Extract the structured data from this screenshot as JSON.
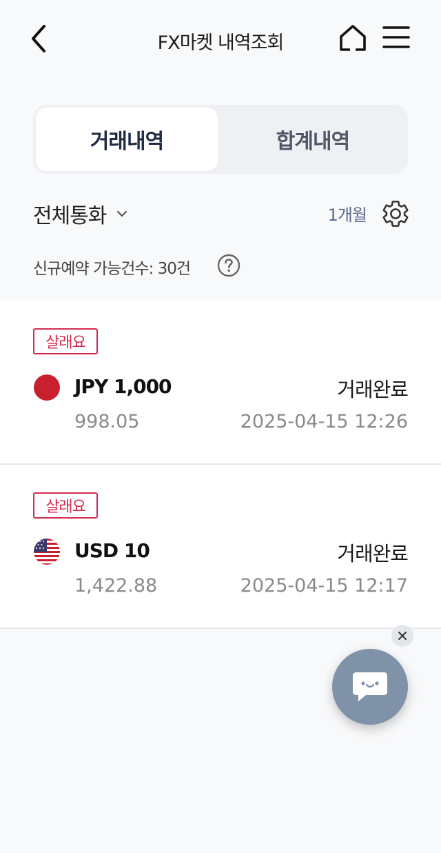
{
  "header": {
    "title": "FX마켓 내역조회",
    "back_icon": "chevron-left-icon",
    "home_icon": "home-icon",
    "menu_icon": "hamburger-menu-icon"
  },
  "tabs": [
    {
      "label": "거래내역",
      "active": true
    },
    {
      "label": "합계내역",
      "active": false
    }
  ],
  "filters": {
    "currency_label": "전체통화",
    "period_label": "1개월",
    "settings_icon": "gear-icon"
  },
  "reserve_info": {
    "text": "신규예약 가능건수: 30건",
    "help_icon": "question-circle-icon"
  },
  "transactions": [
    {
      "badge": "살래요",
      "flag_icon": "japan-flag-icon",
      "amount": "JPY 1,000",
      "status": "거래완료",
      "rate": "998.05",
      "datetime": "2025-04-15 12:26"
    },
    {
      "badge": "살래요",
      "flag_icon": "usa-flag-icon",
      "amount": "USD 10",
      "status": "거래완료",
      "rate": "1,422.88",
      "datetime": "2025-04-15 12:17"
    }
  ],
  "chat": {
    "close_icon": "close-icon",
    "chat_icon": "chat-bubble-icon"
  },
  "colors": {
    "background": "#f8f9fa",
    "badge_red": "#d6294f",
    "accent_navy": "#1f2a44",
    "period_blue": "#5a6b8c",
    "chat_fab": "#7f92a8"
  }
}
